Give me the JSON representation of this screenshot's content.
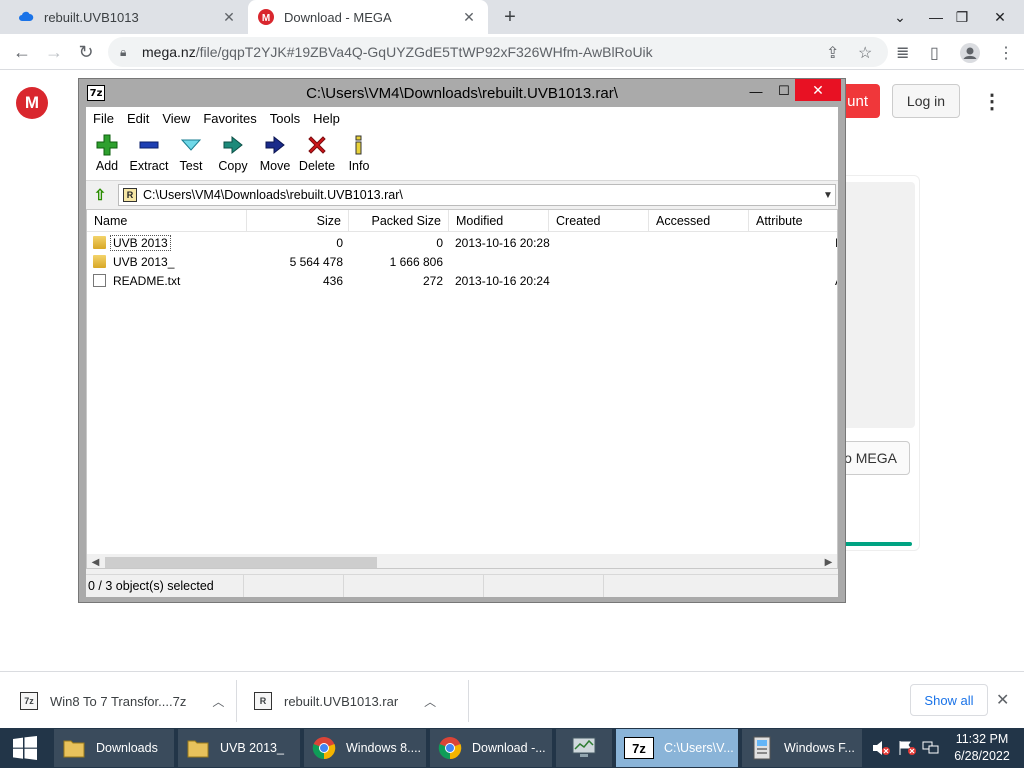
{
  "browser": {
    "tabs": [
      {
        "label": "rebuilt.UVB1013",
        "close": "✕"
      },
      {
        "label": "Download - MEGA",
        "close": "✕"
      }
    ],
    "new_tab": "+",
    "url_host": "mega.nz",
    "url_path": "/file/gqpT2YJK#19ZBVa4Q-GqUYZGdE5TtWP92xF326WHfm-AwBlRoUik"
  },
  "mega": {
    "logo": "M",
    "create_account_fragment": "unt",
    "login": "Log in",
    "save_fragment": "o MEGA",
    "brand_color": "#d9272e"
  },
  "sevenzip": {
    "title": "C:\\Users\\VM4\\Downloads\\rebuilt.UVB1013.rar\\",
    "app_icon": "7z",
    "menu": [
      "File",
      "Edit",
      "View",
      "Favorites",
      "Tools",
      "Help"
    ],
    "toolbar": [
      {
        "label": "Add",
        "icon": "add-icon"
      },
      {
        "label": "Extract",
        "icon": "extract-icon"
      },
      {
        "label": "Test",
        "icon": "test-icon"
      },
      {
        "label": "Copy",
        "icon": "copy-icon"
      },
      {
        "label": "Move",
        "icon": "move-icon"
      },
      {
        "label": "Delete",
        "icon": "delete-icon"
      },
      {
        "label": "Info",
        "icon": "info-icon"
      }
    ],
    "address": "C:\\Users\\VM4\\Downloads\\rebuilt.UVB1013.rar\\",
    "columns": [
      "Name",
      "Size",
      "Packed Size",
      "Modified",
      "Created",
      "Accessed",
      "Attribute"
    ],
    "files": [
      {
        "name": "UVB 2013",
        "size": "0",
        "packed": "0",
        "modified": "2013-10-16 20:28",
        "created": "",
        "accessed": "",
        "attr": "I",
        "type": "folder"
      },
      {
        "name": "UVB 2013_",
        "size": "5 564 478",
        "packed": "1 666 806",
        "modified": "",
        "created": "",
        "accessed": "",
        "attr": "",
        "type": "folder"
      },
      {
        "name": "README.txt",
        "size": "436",
        "packed": "272",
        "modified": "2013-10-16 20:24",
        "created": "",
        "accessed": "",
        "attr": "A",
        "type": "file"
      }
    ],
    "status": "0 / 3 object(s) selected"
  },
  "downloads": {
    "items": [
      {
        "label": "Win8 To 7 Transfor....7z",
        "icon": "7z"
      },
      {
        "label": "rebuilt.UVB1013.rar",
        "icon": "R"
      }
    ],
    "show_all": "Show all"
  },
  "taskbar": {
    "items": [
      {
        "label": "Downloads",
        "icon": "folder-icon"
      },
      {
        "label": "UVB 2013_",
        "icon": "folder-icon"
      },
      {
        "label": "Windows 8....",
        "icon": "chrome-icon"
      },
      {
        "label": "Download -...",
        "icon": "chrome-icon"
      },
      {
        "label": "",
        "icon": "monitor-icon"
      },
      {
        "label": "C:\\Users\\V...",
        "icon": "7z"
      },
      {
        "label": "Windows F...",
        "icon": "installer-icon"
      }
    ],
    "time": "11:32 PM",
    "date": "6/28/2022"
  }
}
